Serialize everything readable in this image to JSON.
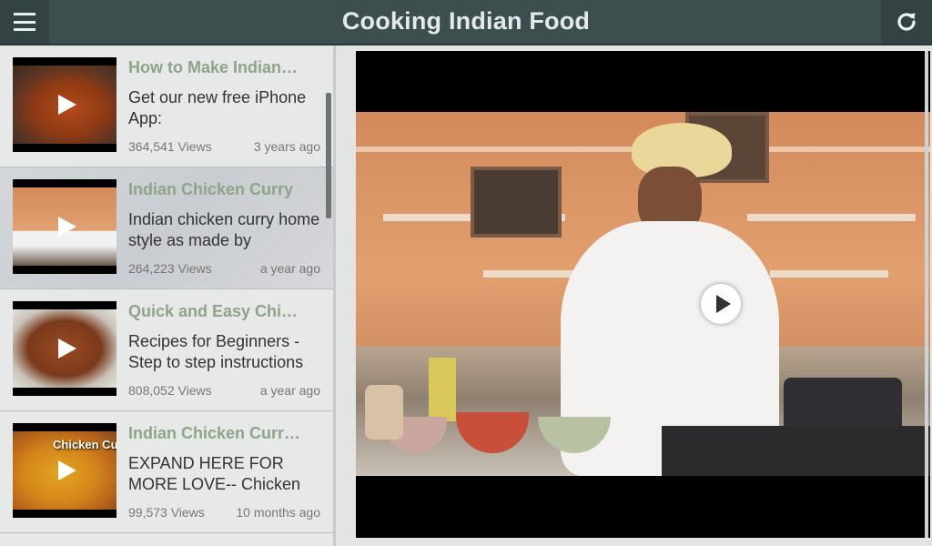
{
  "app": {
    "title": "Cooking Indian Food"
  },
  "colors": {
    "topbar": "#3d4e4e",
    "title_text": "#e4eaea",
    "item_title": "#8fa488"
  },
  "icons": {
    "menu": "hamburger-icon",
    "refresh": "refresh-icon",
    "play": "play-icon"
  },
  "videos": [
    {
      "title": "How to Make Indian…",
      "desc": "Get our new free iPhone App:",
      "views": "364,541 Views",
      "age": "3 years ago"
    },
    {
      "title": "Indian Chicken Curry",
      "desc": "Indian chicken curry home style as made by",
      "views": "264,223 Views",
      "age": "a year ago"
    },
    {
      "title": "Quick and Easy Chi…",
      "desc": "Recipes for Beginners - Step to step instructions",
      "views": "808,052 Views",
      "age": "a year ago"
    },
    {
      "title": "Indian Chicken Curr…",
      "desc": "EXPAND HERE FOR MORE LOVE-- Chicken",
      "views": "99,573 Views",
      "age": "10 months ago",
      "thumb_text": "Chicken Cu"
    }
  ]
}
